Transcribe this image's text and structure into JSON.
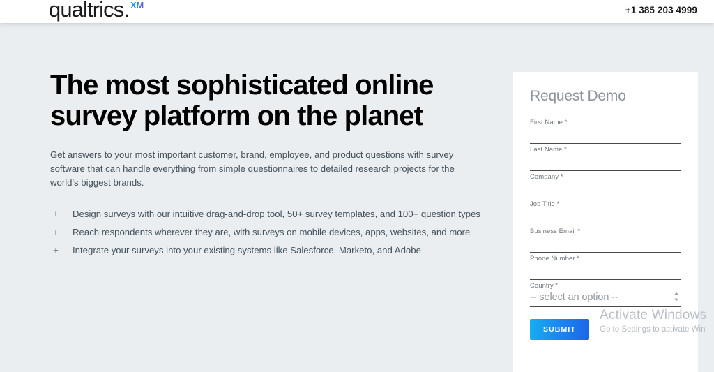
{
  "header": {
    "logo_word": "qualtrics",
    "logo_dot": ".",
    "logo_superscript": "XM",
    "phone": "+1 385 203 4999"
  },
  "hero": {
    "title_line1": "The most sophisticated online",
    "title_line2": "survey platform on the planet",
    "body": "Get answers to your most important customer, brand, employee, and product questions with survey software that can handle everything from simple questionnaires to detailed research projects for the world's biggest brands.",
    "bullet_marker": "+",
    "bullets": [
      "Design surveys with our intuitive drag-and-drop tool, 50+ survey templates, and 100+ question types",
      "Reach respondents wherever they are, with surveys on mobile devices, apps, websites, and more",
      "Integrate your surveys into your existing systems like Salesforce, Marketo, and Adobe"
    ]
  },
  "form": {
    "title": "Request Demo",
    "fields": [
      {
        "label": "First Name *",
        "value": "",
        "placeholder": ""
      },
      {
        "label": "Last Name *",
        "value": "",
        "placeholder": ""
      },
      {
        "label": "Company *",
        "value": "",
        "placeholder": ""
      },
      {
        "label": "Job Title *",
        "value": "",
        "placeholder": ""
      },
      {
        "label": "Business Email *",
        "value": "",
        "placeholder": ""
      },
      {
        "label": "Phone Number *",
        "value": "",
        "placeholder": ""
      }
    ],
    "country": {
      "label": "Country *",
      "selected": "-- select an option --",
      "options": [
        "-- select an option --"
      ]
    },
    "submit_label": "SUBMIT"
  },
  "watermark": {
    "title": "Activate Windows",
    "subtitle": "Go to Settings to activate Win"
  },
  "colors": {
    "page_background": "#eaeef1",
    "card_background": "#ffffff",
    "accent_blue": "#1c82ef",
    "text_dark": "#000000",
    "text_body": "#44525c",
    "label_gray": "#6e767e"
  }
}
